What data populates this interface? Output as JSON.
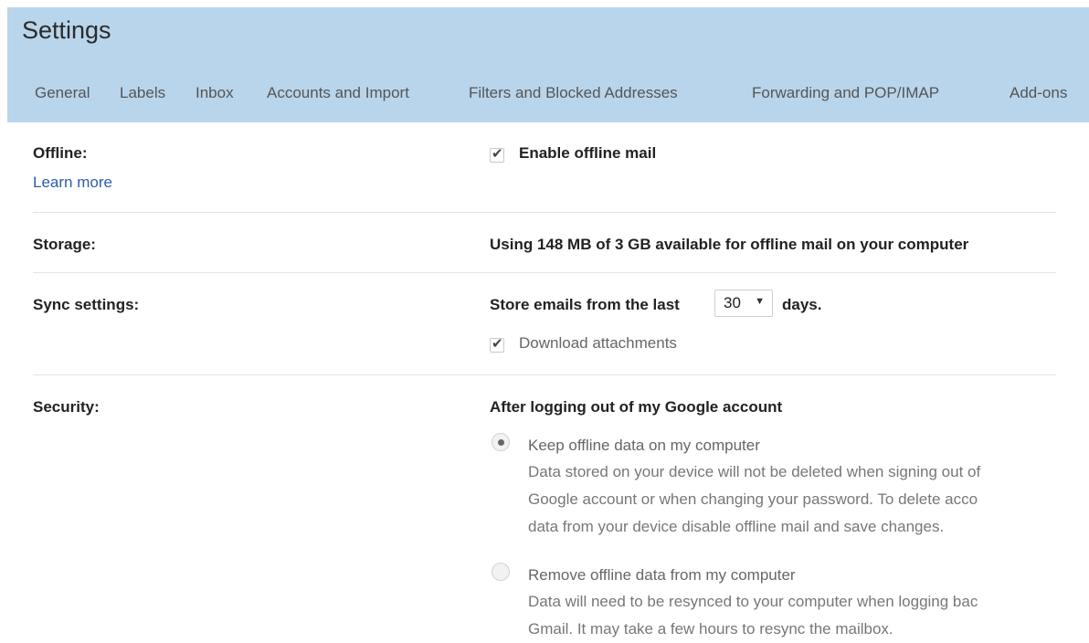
{
  "header": {
    "title": "Settings",
    "tabs": [
      {
        "label": "General"
      },
      {
        "label": "Labels"
      },
      {
        "label": "Inbox"
      },
      {
        "label": "Accounts and Import"
      },
      {
        "label": "Filters and Blocked Addresses"
      },
      {
        "label": "Forwarding and POP/IMAP"
      },
      {
        "label": "Add-ons"
      }
    ],
    "accent_color": "#b9d5ec"
  },
  "offline": {
    "label": "Offline:",
    "learn_more": "Learn more",
    "enable_label": "Enable offline mail",
    "enable_checked": true
  },
  "storage": {
    "label": "Storage:",
    "text": "Using 148 MB of 3 GB available for offline mail on your computer"
  },
  "sync": {
    "label": "Sync settings:",
    "prefix": "Store emails from the last",
    "days_value": "30",
    "suffix": "days.",
    "download_label": "Download attachments",
    "download_checked": true
  },
  "security": {
    "label": "Security:",
    "heading": "After logging out of my Google account",
    "options": [
      {
        "label": "Keep offline data on my computer",
        "selected": true,
        "description": [
          "Data stored on your device will not be deleted when signing out of",
          "Google account or when changing your password. To delete acco",
          "data from your device disable offline mail and save changes."
        ]
      },
      {
        "label": "Remove offline data from my computer",
        "selected": false,
        "description": [
          "Data will need to be resynced to your computer when logging bac",
          "Gmail. It may take a few hours to resync the mailbox."
        ]
      }
    ]
  }
}
